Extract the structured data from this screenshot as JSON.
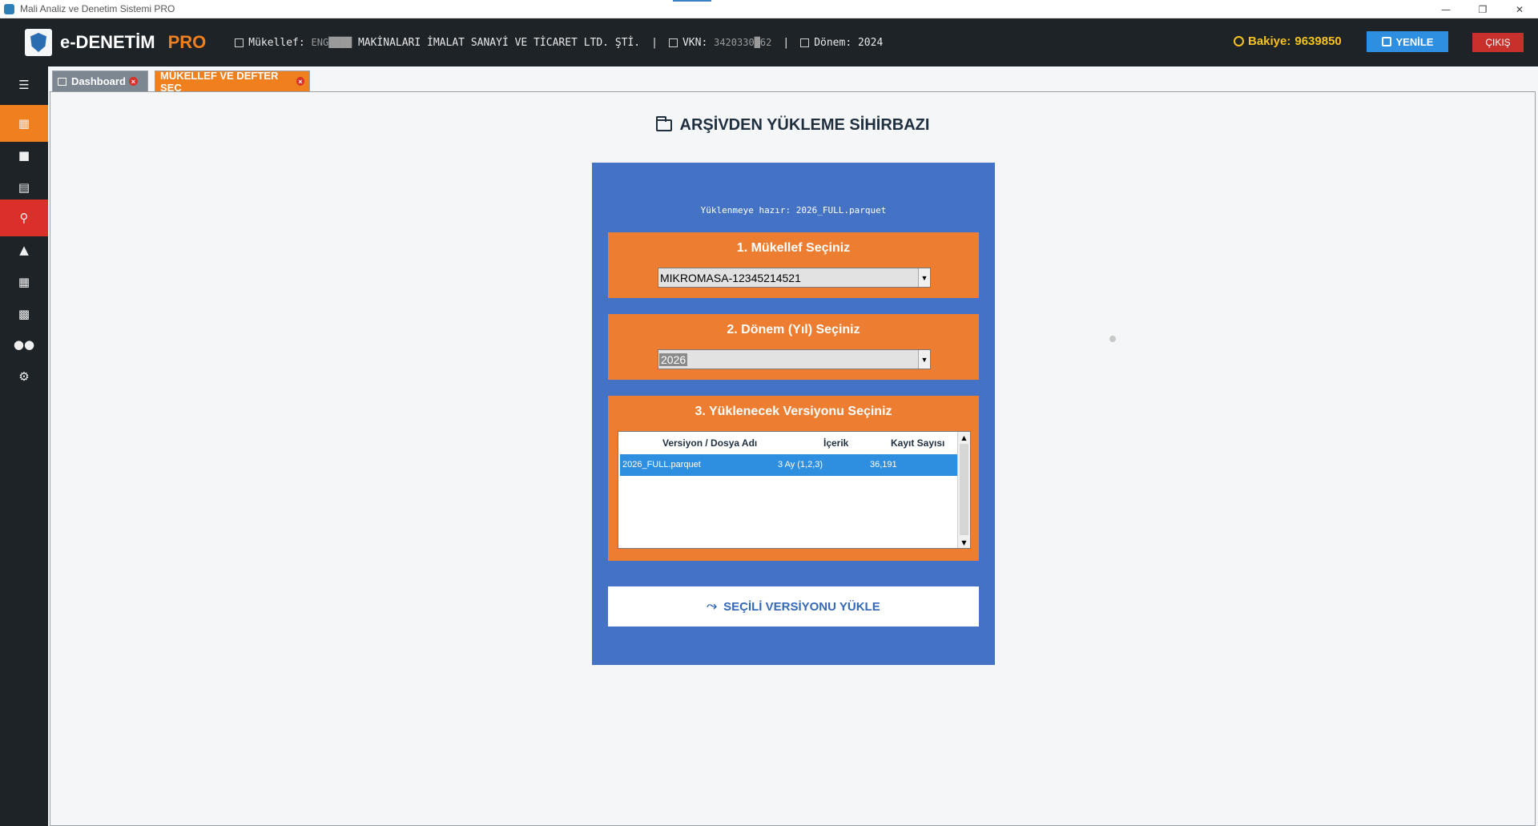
{
  "os_window": {
    "title": "Mali Analiz ve Denetim Sistemi PRO",
    "minimize_icon": "minimize-icon",
    "maximize_icon": "restore-icon",
    "close_icon": "close-icon"
  },
  "header": {
    "brand": "e-DENETİM",
    "brand_suffix": "PRO",
    "mukellef_label": "Mükellef:",
    "mukellef_redacted": "ENG████",
    "mukellef_name": "MAKİNALARI İMALAT SANAYİ VE TİCARET LTD. ŞTİ.",
    "vkn_label": "VKN:",
    "vkn_value": "3420330█62",
    "donem_label": "Dönem:",
    "donem_value": "2024",
    "separator": "|",
    "balance_label": "Bakiye:",
    "balance_value": "9639850",
    "refresh_label": "YENİLE",
    "exit_label": "ÇIKIŞ"
  },
  "sidebar": {
    "menu_icon": "hamburger-icon",
    "items": [
      {
        "icon": "building-icon",
        "state": "active"
      },
      {
        "icon": "briefcase-icon",
        "state": "normal"
      },
      {
        "icon": "document-icon",
        "state": "normal"
      },
      {
        "icon": "search-icon",
        "state": "highlight"
      },
      {
        "icon": "chart-icon",
        "state": "normal"
      },
      {
        "icon": "bank-icon",
        "state": "normal"
      },
      {
        "icon": "files-icon",
        "state": "normal"
      },
      {
        "icon": "users-icon",
        "state": "normal"
      },
      {
        "icon": "settings-icon",
        "state": "normal"
      }
    ]
  },
  "tabs": [
    {
      "label": "Dashboard",
      "active": false
    },
    {
      "label": "MÜKELLEF VE DEFTER SEÇ",
      "active": true
    }
  ],
  "page": {
    "title": "ARŞİVDEN YÜKLEME SİHİRBAZI",
    "ready_text": "Yüklenmeye hazır: 2026_FULL.parquet",
    "step1_label": "1. Mükellef Seçiniz",
    "step1_value": "MIKROMASA-12345214521",
    "step2_label": "2. Dönem (Yıl) Seçiniz",
    "step2_value": "2026",
    "step3_label": "3. Yüklenecek Versiyonu Seçiniz",
    "table": {
      "columns": [
        "Versiyon / Dosya Adı",
        "İçerik",
        "Kayıt Sayısı"
      ],
      "rows": [
        {
          "file": "2026_FULL.parquet",
          "content": "3 Ay (1,2,3)",
          "count": "36,191",
          "selected": true
        }
      ]
    },
    "load_button": "SEÇİLİ VERSİYONU YÜKLE"
  },
  "colors": {
    "header_bg": "#1e2328",
    "accent_orange": "#ed7d31",
    "wizard_blue": "#4472c4",
    "balance_yellow": "#f6c21b",
    "refresh_blue": "#2e8fe0",
    "exit_red": "#c8302c"
  }
}
